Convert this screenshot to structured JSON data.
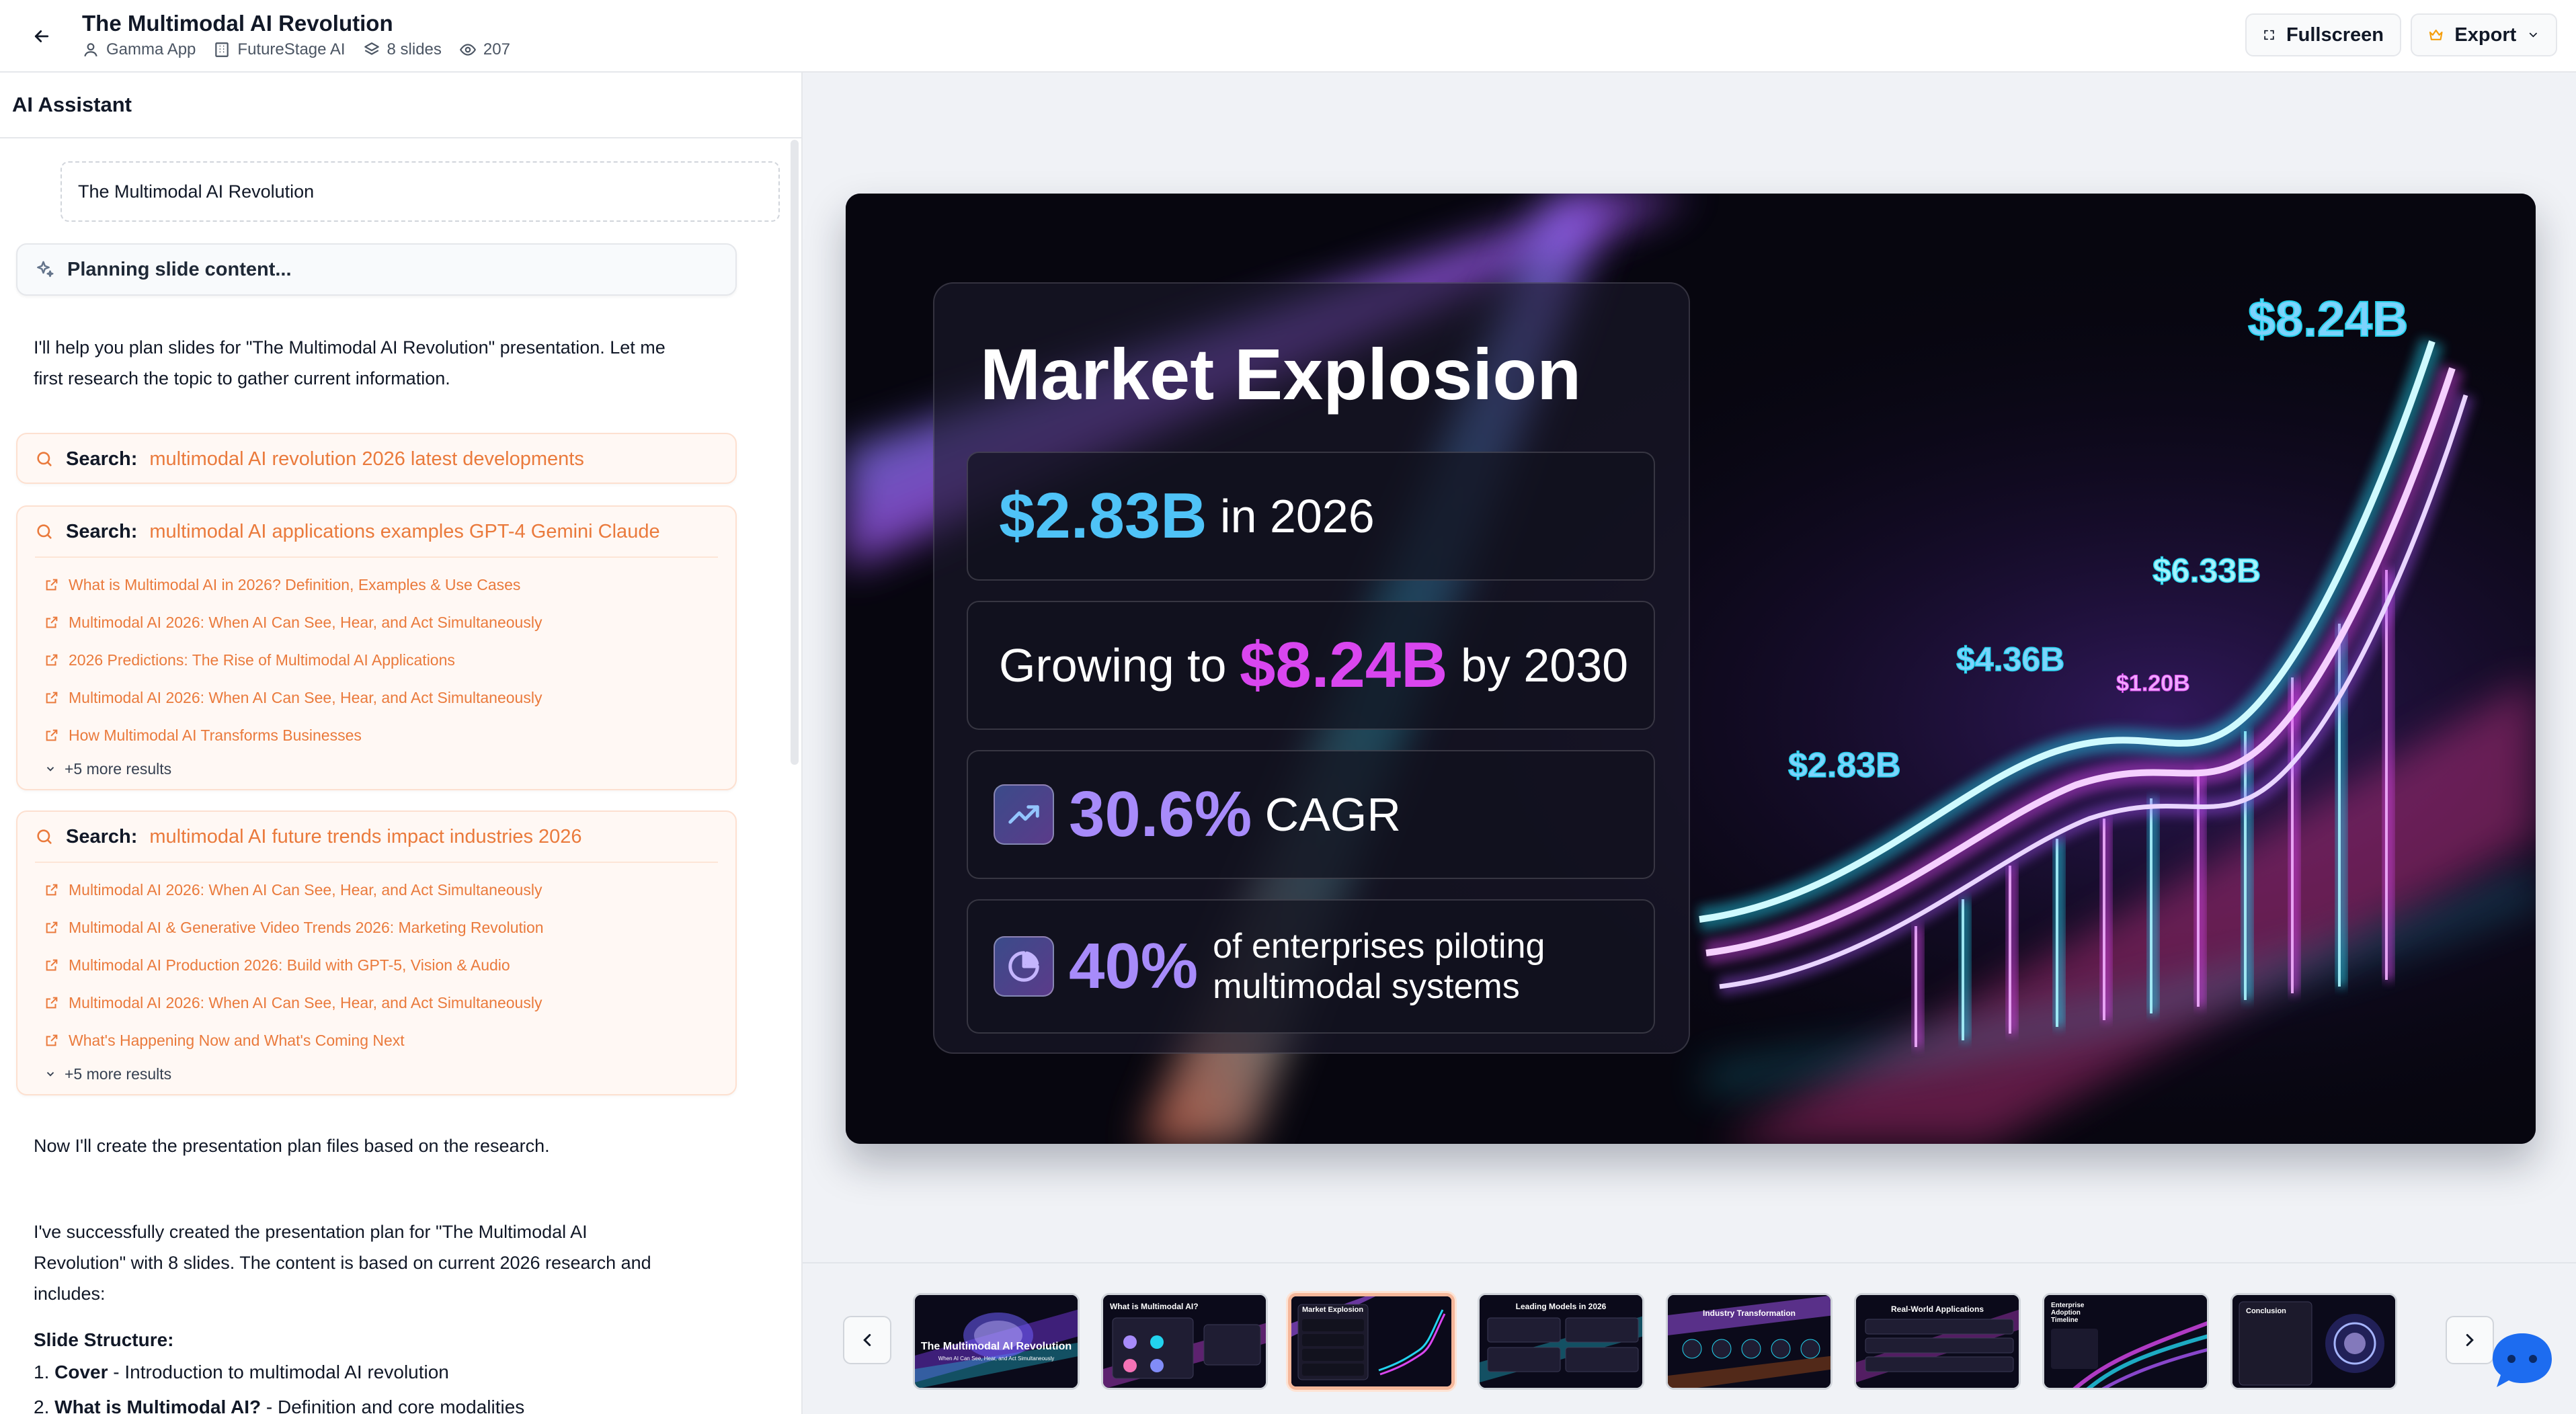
{
  "header": {
    "title": "The Multimodal AI Revolution",
    "meta": {
      "app": "Gamma App",
      "company": "FutureStage AI",
      "slides": "8 slides",
      "views": "207"
    },
    "fullscreen_label": "Fullscreen",
    "export_label": "Export"
  },
  "assistant": {
    "title": "AI Assistant",
    "user_message": "The Multimodal AI Revolution",
    "status": "Planning slide content...",
    "intro_line1": "I'll help you plan slides for \"The Multimodal AI Revolution\" presentation. Let me",
    "intro_line2": "first research the topic to gather current information.",
    "search_prefix": "Search:",
    "searches": [
      {
        "query": "multimodal AI revolution 2026 latest developments",
        "results": [],
        "more": ""
      },
      {
        "query": "multimodal AI applications examples GPT-4 Gemini Claude",
        "results": [
          "What is Multimodal AI in 2026? Definition, Examples & Use Cases",
          "Multimodal AI 2026: When AI Can See, Hear, and Act Simultaneously",
          "2026 Predictions: The Rise of Multimodal AI Applications",
          "Multimodal AI 2026: When AI Can See, Hear, and Act Simultaneously",
          "How Multimodal AI Transforms Businesses"
        ],
        "more": "+5 more results"
      },
      {
        "query": "multimodal AI future trends impact industries 2026",
        "results": [
          "Multimodal AI 2026: When AI Can See, Hear, and Act Simultaneously",
          "Multimodal AI & Generative Video Trends 2026: Marketing Revolution",
          "Multimodal AI Production 2026: Build with GPT-5, Vision & Audio",
          "Multimodal AI 2026: When AI Can See, Hear, and Act Simultaneously",
          "What's Happening Now and What's Coming Next"
        ],
        "more": "+5 more results"
      }
    ],
    "plan_msg": "Now I'll create the presentation plan files based on the research.",
    "success_line1": "I've successfully created the presentation plan for \"The Multimodal AI",
    "success_line2": "Revolution\" with 8 slides. The content is based on current 2026 research and",
    "success_line3": "includes:",
    "structure_title": "Slide Structure:",
    "structure": [
      {
        "num": "1.",
        "name": "Cover",
        "desc": " - Introduction to multimodal AI revolution"
      },
      {
        "num": "2.",
        "name": "What is Multimodal AI?",
        "desc": " - Definition and core modalities"
      }
    ]
  },
  "slide": {
    "title": "Market Explosion",
    "stat1_value": "$2.83B",
    "stat1_text": " in 2026",
    "stat2_pre": "Growing to ",
    "stat2_value": "$8.24B",
    "stat2_post": " by 2030",
    "stat3_value": "30.6%",
    "stat3_text": " CAGR",
    "stat4_value": "40%",
    "stat4_line1": "of enterprises piloting",
    "stat4_line2": "multimodal systems",
    "chart_labels": [
      "$2.83B",
      "$4.36B",
      "$1.20B",
      "$6.33B",
      "$8.24B"
    ]
  },
  "thumbnails": [
    {
      "label": "The Multimodal AI Revolution",
      "sub": "When AI Can See, Hear, and Act Simultaneously"
    },
    {
      "label": "What is Multimodal AI?",
      "sub": ""
    },
    {
      "label": "Market Explosion",
      "sub": ""
    },
    {
      "label": "Leading Models in 2026",
      "sub": ""
    },
    {
      "label": "Industry Transformation",
      "sub": ""
    },
    {
      "label": "Real-World Applications",
      "sub": ""
    },
    {
      "label": "Enterprise Adoption Timeline",
      "sub": ""
    },
    {
      "label": "Conclusion",
      "sub": ""
    }
  ],
  "colors": {
    "accent_orange": "#ea7a3c",
    "neon_cyan": "#4fc3f7",
    "neon_pink": "#d946ef",
    "neon_purple": "#a78bfa"
  }
}
